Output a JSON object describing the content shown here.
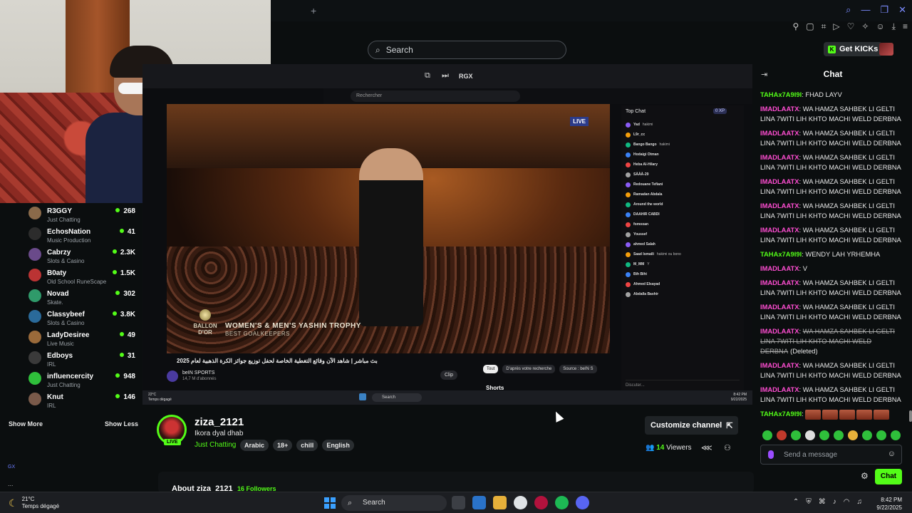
{
  "browser": {
    "new_tab": "+",
    "search_placeholder": "Search",
    "get_kicks": "Get KICKs"
  },
  "stream_video": {
    "inner_label": "RGX",
    "yt_search": "Rechercher",
    "live_badge": "LIVE",
    "ballon_dor": "BALLON D'OR",
    "trophy_title": "WOMEN'S & MEN'S YASHIN TROPHY",
    "trophy_sub": "BEST GOALKEEPERS",
    "video_title": "بث مباشر | شاهد الآن وقائع التغطية الخاصة لحفل توزيع جوائز الكرة الذهبية لعام 2025",
    "yt_channel": "beIN SPORTS",
    "yt_subs": "14,7 M d'abonnés",
    "clip": "Clip",
    "filters": [
      "Tout",
      "D'après votre recherche",
      "Source : beIN S"
    ],
    "shorts": "Shorts",
    "top_chat": "Top Chat",
    "xp": "0 XP",
    "top_chat_users": [
      "Yad",
      "L9r_cc",
      "Bango Bango",
      "Hodaigi Otman",
      "Heba Al-Hilary",
      "SÀÀÀ-29",
      "Redouane Tefiani",
      "Ramadan Abdala",
      "Around the world",
      "DAAHIR CABDI",
      "fomooan",
      "Youssef",
      "ahmed Salah",
      "Saad Ismaili",
      "M_MM",
      "Bih Bihi",
      "Ahmed Elsayad",
      "Abdalla Bashir"
    ],
    "top_chat_msgs": [
      "hakimi",
      "",
      "hakimi",
      "",
      "",
      "",
      "",
      "",
      "",
      "",
      "",
      "",
      "",
      "hakimi ou bono",
      "Y",
      "",
      "",
      ""
    ],
    "discuss": "Discuter...",
    "inner_temp": "22°C",
    "inner_weather": "Temps dégagé",
    "inner_search": "Search",
    "inner_time": "8:42 PM",
    "inner_date": "9/22/2025"
  },
  "sidebar": {
    "channels": [
      {
        "name": "R3GGY",
        "category": "Just Chatting",
        "viewers": "268",
        "color": "#8a6a4a"
      },
      {
        "name": "EchosNation",
        "category": "Music Production",
        "viewers": "41",
        "color": "#2c2c2c"
      },
      {
        "name": "Cabrzy",
        "category": "Slots & Casino",
        "viewers": "2.3K",
        "color": "#6a4a8a"
      },
      {
        "name": "B0aty",
        "category": "Old School RuneScape",
        "viewers": "1.5K",
        "color": "#b33"
      },
      {
        "name": "Novad",
        "category": "Skate.",
        "viewers": "302",
        "color": "#2f9a6a"
      },
      {
        "name": "Classybeef",
        "category": "Slots & Casino",
        "viewers": "3.8K",
        "color": "#2a6a9a"
      },
      {
        "name": "LadyDesiree",
        "category": "Live Music",
        "viewers": "49",
        "color": "#9a6a3a"
      },
      {
        "name": "Edboys",
        "category": "IRL",
        "viewers": "31",
        "color": "#3a3a3a"
      },
      {
        "name": "influencercity",
        "category": "Just Chatting",
        "viewers": "948",
        "color": "#2fbf3b"
      },
      {
        "name": "Knut",
        "category": "IRL",
        "viewers": "146",
        "color": "#7a5a4a"
      }
    ],
    "show_more": "Show More",
    "show_less": "Show Less",
    "gx": "GX",
    "more": "..."
  },
  "channel": {
    "streamer": "ziza_2121",
    "title": "Ikora dyal dhab",
    "live": "LIVE",
    "category": "Just Chatting",
    "tags": [
      "Arabic",
      "18+",
      "chill",
      "English"
    ],
    "customize": "Customize channel",
    "viewers_count": "14",
    "viewers_label": "Viewers",
    "about": "About ziza_2121",
    "followers": "16 Followers"
  },
  "chat": {
    "title": "Chat",
    "messages": [
      {
        "user": "TAHAx7A9I9I",
        "color": "#53fc18",
        "text": "FHAD LAYV",
        "deleted": false
      },
      {
        "user": "IMADLAATX",
        "color": "#ff4dd2",
        "text": "WA HAMZA SAHBEK LI GELTI LINA 7WITI LIH KHTO MACHI WELD DERBNA",
        "deleted": false
      },
      {
        "user": "IMADLAATX",
        "color": "#ff4dd2",
        "text": "WA HAMZA SAHBEK LI GELTI LINA 7WITI LIH KHTO MACHI WELD DERBNA",
        "deleted": false
      },
      {
        "user": "IMADLAATX",
        "color": "#ff4dd2",
        "text": "WA HAMZA SAHBEK LI GELTI LINA 7WITI LIH KHTO MACHI WELD DERBNA",
        "deleted": false
      },
      {
        "user": "IMADLAATX",
        "color": "#ff4dd2",
        "text": "WA HAMZA SAHBEK LI GELTI LINA 7WITI LIH KHTO MACHI WELD DERBNA",
        "deleted": false
      },
      {
        "user": "IMADLAATX",
        "color": "#ff4dd2",
        "text": "WA HAMZA SAHBEK LI GELTI LINA 7WITI LIH KHTO MACHI WELD DERBNA",
        "deleted": false
      },
      {
        "user": "IMADLAATX",
        "color": "#ff4dd2",
        "text": "WA HAMZA SAHBEK LI GELTI LINA 7WITI LIH KHTO MACHI WELD DERBNA",
        "deleted": false
      },
      {
        "user": "TAHAx7A9I9I",
        "color": "#53fc18",
        "text": "WENDY LAH YRHEMHA",
        "deleted": false
      },
      {
        "user": "IMADLAATX",
        "color": "#ff4dd2",
        "text": "V",
        "deleted": false
      },
      {
        "user": "IMADLAATX",
        "color": "#ff4dd2",
        "text": "WA HAMZA SAHBEK LI GELTI LINA 7WITI LIH KHTO MACHI WELD DERBNA",
        "deleted": false
      },
      {
        "user": "IMADLAATX",
        "color": "#ff4dd2",
        "text": "WA HAMZA SAHBEK LI GELTI LINA 7WITI LIH KHTO MACHI WELD DERBNA",
        "deleted": false
      },
      {
        "user": "IMADLAATX",
        "color": "#ff4dd2",
        "text": "WA HAMZA SAHBEK LI GELTI LINA 7WITI LIH KHTO MACHI WELD DERBNA",
        "deleted": true,
        "note": "(Deleted)"
      },
      {
        "user": "IMADLAATX",
        "color": "#ff4dd2",
        "text": "WA HAMZA SAHBEK LI GELTI LINA 7WITI LIH KHTO MACHI WELD DERBNA",
        "deleted": false
      },
      {
        "user": "IMADLAATX",
        "color": "#ff4dd2",
        "text": "WA HAMZA SAHBEK LI GELTI LINA 7WITI LIH KHTO MACHI WELD DERBNA",
        "deleted": false
      },
      {
        "user": "TAHAx7A9I9I",
        "color": "#53fc18",
        "text": "",
        "deleted": false,
        "emotes": 5
      }
    ],
    "send_placeholder": "Send a message",
    "send_button": "Chat"
  },
  "taskbar": {
    "temp": "21°C",
    "weather": "Temps dégagé",
    "search": "Search",
    "time": "8:42 PM",
    "date": "9/22/2025"
  }
}
